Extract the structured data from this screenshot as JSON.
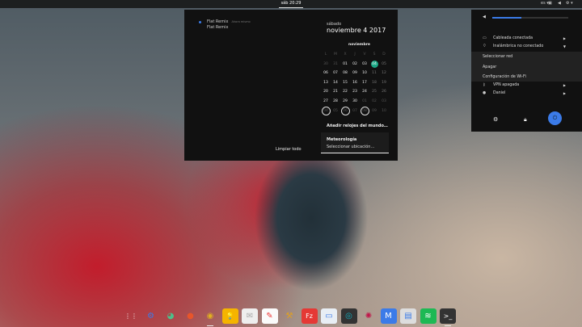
{
  "topbar": {
    "clock": "sáb 20:29",
    "keyboard": "es ▾"
  },
  "notifications": {
    "items": [
      {
        "app": "Flat Remix",
        "time": "Ahora mismo",
        "body": "Flat Remix"
      }
    ],
    "clear_label": "Limpiar todo"
  },
  "calendar": {
    "day_name": "sábado",
    "date": "noviembre  4 2017",
    "month": "noviembre",
    "weekdays": [
      "L",
      "M",
      "X",
      "J",
      "V",
      "S",
      "D"
    ],
    "weeks": [
      [
        "30",
        "31",
        "01",
        "02",
        "03",
        "04",
        "05"
      ],
      [
        "06",
        "07",
        "08",
        "09",
        "10",
        "11",
        "12"
      ],
      [
        "13",
        "14",
        "15",
        "16",
        "17",
        "18",
        "19"
      ],
      [
        "20",
        "21",
        "22",
        "23",
        "24",
        "25",
        "26"
      ],
      [
        "27",
        "28",
        "29",
        "30",
        "01",
        "02",
        "03"
      ],
      [
        "04",
        "05",
        "06",
        "07",
        "08",
        "09",
        "10"
      ]
    ],
    "today": "04",
    "accent": "#1aa785",
    "world_clocks": "Añadir relojes del mundo…",
    "weather_title": "Meteorología",
    "weather_action": "Seleccionar ubicación…"
  },
  "status_menu": {
    "volume_percent": 38,
    "accent": "#3b7be8",
    "wired": "Cableada conectada",
    "wireless": "Inalámbrica no conectado",
    "wifi_sub": [
      "Seleccionar red",
      "Apagar",
      "Configuración de Wi-Fi"
    ],
    "vpn": "VPN apagada",
    "user": "Daniel"
  },
  "dock": [
    {
      "name": "app-grid",
      "glyph": "⋮⋮",
      "bg": "transparent"
    },
    {
      "name": "settings",
      "glyph": "⚙",
      "bg": "transparent",
      "fg": "#3b7be8"
    },
    {
      "name": "piechart",
      "glyph": "◕",
      "bg": "transparent",
      "fg": "#4cc08a"
    },
    {
      "name": "firefox",
      "glyph": "●",
      "bg": "transparent",
      "fg": "#e8552a"
    },
    {
      "name": "chrome",
      "glyph": "◉",
      "bg": "transparent",
      "fg": "#e0b020",
      "run": true
    },
    {
      "name": "keep",
      "glyph": "💡",
      "bg": "#f5b400"
    },
    {
      "name": "mail",
      "glyph": "✉",
      "bg": "#eee",
      "fg": "#aaa"
    },
    {
      "name": "document",
      "glyph": "✎",
      "bg": "#fafafa",
      "fg": "#e33"
    },
    {
      "name": "robot-arm",
      "glyph": "⚒",
      "bg": "transparent",
      "fg": "#e0a020"
    },
    {
      "name": "filezilla",
      "glyph": "Fz",
      "bg": "#e53935"
    },
    {
      "name": "files",
      "glyph": "▭",
      "bg": "#e8eef4",
      "fg": "#3b7be8"
    },
    {
      "name": "music",
      "glyph": "◎",
      "bg": "#333",
      "fg": "#1ab"
    },
    {
      "name": "debian",
      "glyph": "✺",
      "bg": "transparent",
      "fg": "#c0164a"
    },
    {
      "name": "monitor",
      "glyph": "M",
      "bg": "#3b7be8"
    },
    {
      "name": "software",
      "glyph": "▤",
      "bg": "#ddd",
      "fg": "#3b7be8"
    },
    {
      "name": "spotify",
      "glyph": "≋",
      "bg": "#1db954"
    },
    {
      "name": "terminal",
      "glyph": ">_",
      "bg": "#333",
      "run": true
    }
  ]
}
